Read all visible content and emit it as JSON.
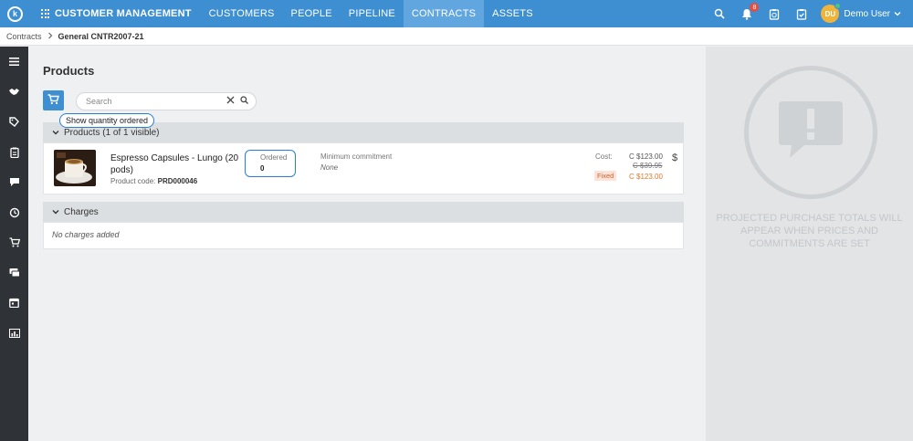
{
  "topbar": {
    "logo_letter": "k",
    "app_name": "CUSTOMER MANAGEMENT",
    "nav": [
      {
        "label": "CUSTOMERS",
        "active": false
      },
      {
        "label": "PEOPLE",
        "active": false
      },
      {
        "label": "PIPELINE",
        "active": false
      },
      {
        "label": "CONTRACTS",
        "active": true
      },
      {
        "label": "ASSETS",
        "active": false
      }
    ],
    "notification_count": "8",
    "user_initials": "DU",
    "user_name": "Demo User",
    "icons": [
      "search-icon",
      "bell-icon",
      "clipboard-clock-icon",
      "clipboard-check-icon",
      "chevron-down-icon"
    ]
  },
  "breadcrumb": {
    "parent": "Contracts",
    "current": "General CNTR2007-21"
  },
  "sidebar": {
    "icons": [
      "menu-icon",
      "handshake-icon",
      "tag-icon",
      "clipboard-icon",
      "chat-icon",
      "history-icon",
      "cart-icon",
      "cards-icon",
      "calendar-icon",
      "chart-icon"
    ]
  },
  "main": {
    "title": "Products",
    "search_placeholder": "Search",
    "tooltip": "Show quantity ordered",
    "products_section": "Products (1 of 1 visible)",
    "product": {
      "name": "Espresso Capsules - Lungo (20 pods)",
      "code_label": "Product code:",
      "code": "PRD000046",
      "ordered_label": "Ordered",
      "ordered_value": "0",
      "min_label": "Minimum commitment",
      "min_value": "None",
      "cost_label": "Cost:",
      "price_current": "C $123.00",
      "price_old": "C $39.95",
      "fixed_label": "Fixed",
      "price_fixed": "C $123.00",
      "currency_icon": "$"
    },
    "charges_section": "Charges",
    "charges_empty": "No charges added"
  },
  "right_panel": {
    "message": "PROJECTED PURCHASE TOTALS WILL APPEAR WHEN PRICES AND COMMITMENTS ARE SET"
  },
  "colors": {
    "topbar": "#3d8fd1",
    "active_nav": "#62a6df",
    "sidebar": "#2f3337",
    "highlight_outline": "#2a7fd4",
    "fixed_badge": "#d9612a"
  }
}
